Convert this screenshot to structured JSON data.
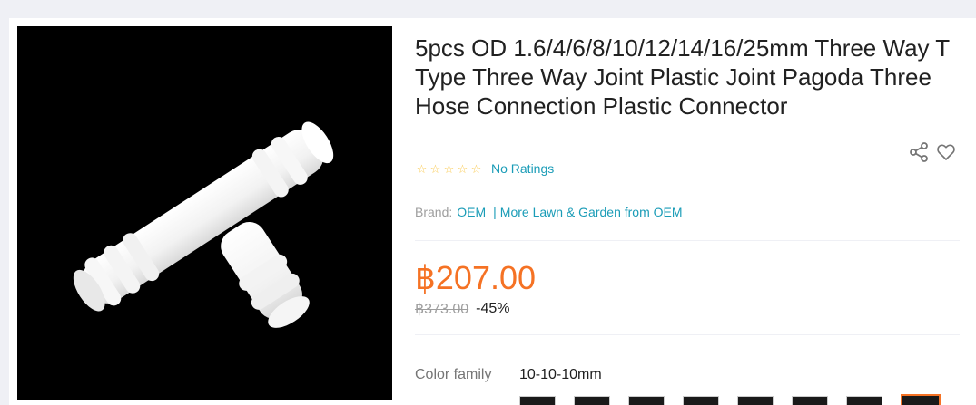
{
  "product": {
    "title": "5pcs OD 1.6/4/6/8/10/12/14/16/25mm Three Way T Type Three Way Joint Plastic Joint Pagoda Three Hose Connection Plastic Connector",
    "image_alt": "White plastic T-shaped three way hose connector"
  },
  "rating": {
    "stars": [
      "☆",
      "☆",
      "☆",
      "☆",
      "☆"
    ],
    "label": "No Ratings"
  },
  "brand": {
    "label": "Brand:",
    "name": "OEM",
    "separator": "|",
    "more_link": "More Lawn & Garden from OEM"
  },
  "pricing": {
    "current": "฿207.00",
    "original": "฿373.00",
    "discount": "-45%"
  },
  "variant": {
    "label": "Color family",
    "selected": "10-10-10mm",
    "swatch_count": 8,
    "selected_index": 7
  },
  "icons": {
    "share": "share-icon",
    "wishlist": "heart-icon"
  },
  "colors": {
    "price": "#f57224",
    "link": "#1a9cb7",
    "star": "#faca51",
    "page_bg": "#eff0f5"
  }
}
